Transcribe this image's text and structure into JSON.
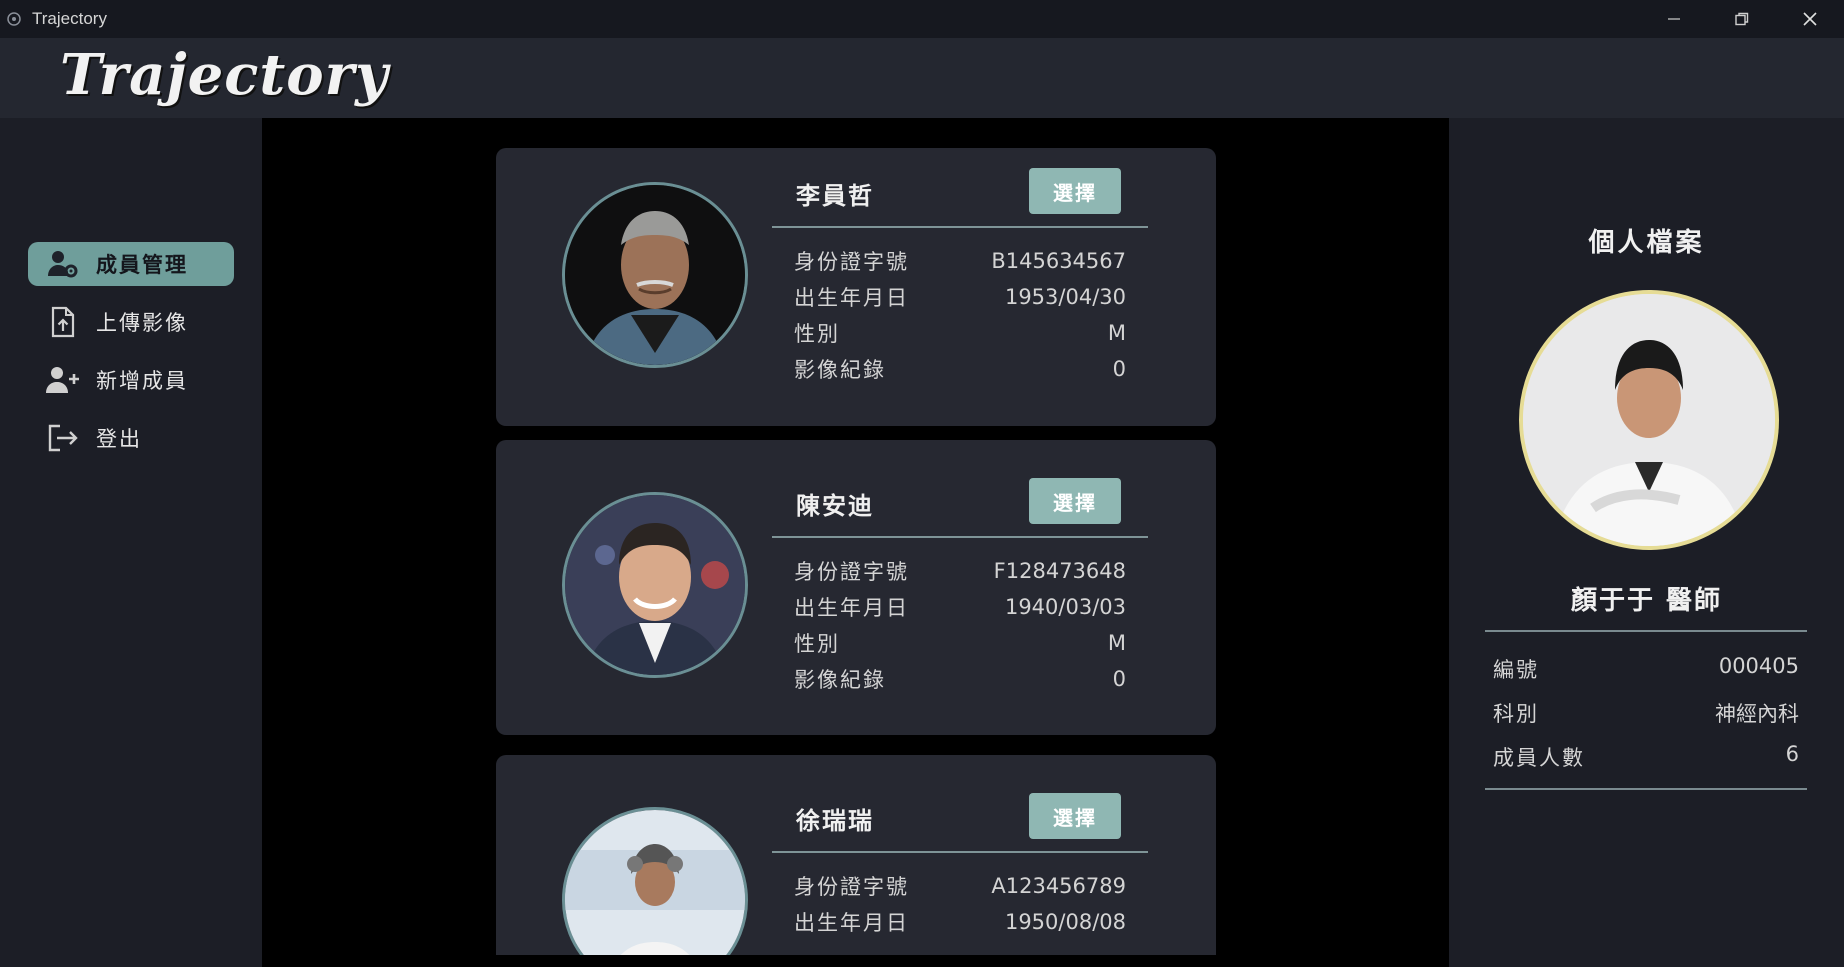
{
  "window": {
    "title": "Trajectory"
  },
  "header": {
    "brand": "Trajectory"
  },
  "sidebar": {
    "items": [
      {
        "label": "成員管理",
        "icon": "user-gear-icon",
        "active": true
      },
      {
        "label": "上傳影像",
        "icon": "file-upload-icon",
        "active": false
      },
      {
        "label": "新增成員",
        "icon": "user-plus-icon",
        "active": false
      },
      {
        "label": "登出",
        "icon": "logout-icon",
        "active": false
      }
    ]
  },
  "members": [
    {
      "name": "李員哲",
      "select_label": "選擇",
      "fields": [
        {
          "label": "身份證字號",
          "value": "B145634567"
        },
        {
          "label": "出生年月日",
          "value": "1953/04/30"
        },
        {
          "label": "性別",
          "value": "M"
        },
        {
          "label": "影像紀錄",
          "value": "0"
        }
      ]
    },
    {
      "name": "陳安迪",
      "select_label": "選擇",
      "fields": [
        {
          "label": "身份證字號",
          "value": "F128473648"
        },
        {
          "label": "出生年月日",
          "value": "1940/03/03"
        },
        {
          "label": "性別",
          "value": "M"
        },
        {
          "label": "影像紀錄",
          "value": "0"
        }
      ]
    },
    {
      "name": "徐瑞瑞",
      "select_label": "選擇",
      "fields": [
        {
          "label": "身份證字號",
          "value": "A123456789"
        },
        {
          "label": "出生年月日",
          "value": "1950/08/08"
        }
      ]
    }
  ],
  "profile": {
    "title": "個人檔案",
    "name": "顏于于 醫師",
    "rows": [
      {
        "label": "編號",
        "value": "000405"
      },
      {
        "label": "科別",
        "value": "神經內科"
      },
      {
        "label": "成員人數",
        "value": "6"
      }
    ]
  },
  "colors": {
    "accent": "#6f9e9b",
    "button": "#8fb7b3",
    "ring": "#e6dc95",
    "card": "#262831"
  }
}
